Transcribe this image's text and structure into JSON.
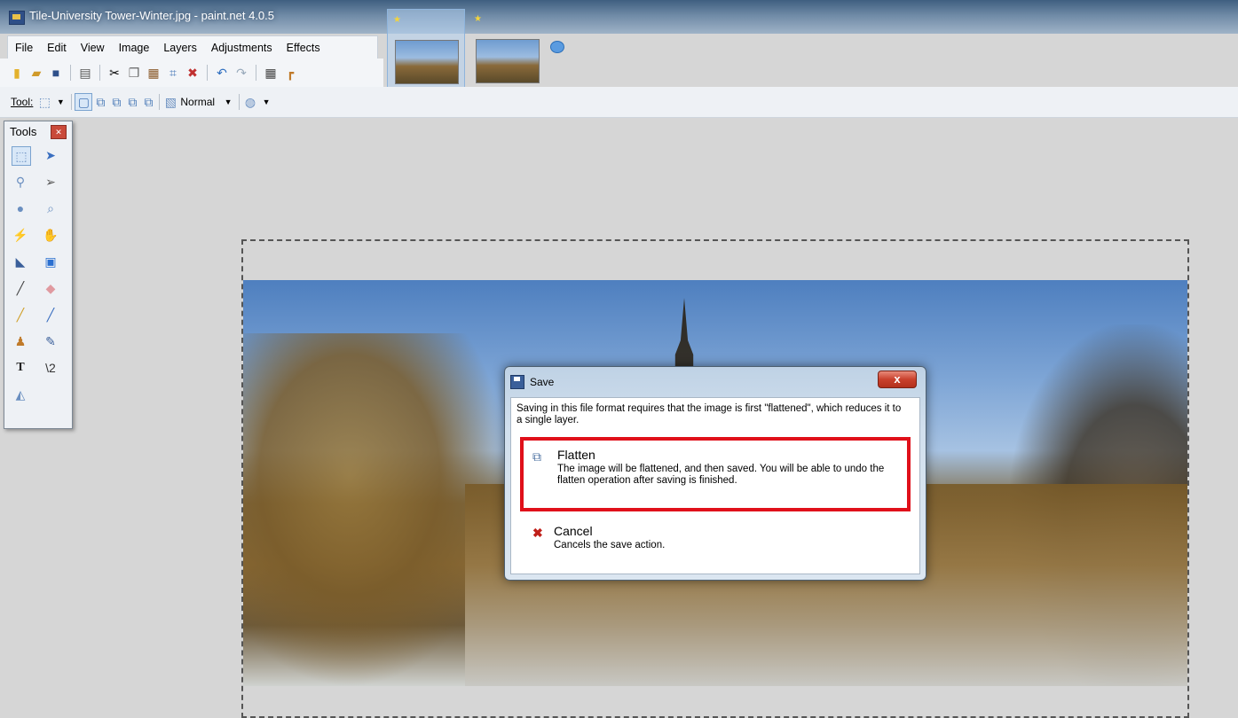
{
  "window": {
    "title": "Tile-University Tower-Winter.jpg - paint.net 4.0.5"
  },
  "menu": {
    "items": [
      {
        "label": "File"
      },
      {
        "label": "Edit"
      },
      {
        "label": "View"
      },
      {
        "label": "Image"
      },
      {
        "label": "Layers"
      },
      {
        "label": "Adjustments"
      },
      {
        "label": "Effects"
      }
    ]
  },
  "toolbar2": {
    "tool_label": "Tool:",
    "blend_mode": "Normal"
  },
  "tools_palette": {
    "title": "Tools"
  },
  "dialog": {
    "title": "Save",
    "close_label": "x",
    "message": "Saving in this file format requires that the image is first \"flattened\", which reduces it to a single layer.",
    "flatten": {
      "title": "Flatten",
      "description": "The image will be flattened, and then saved. You will be able to undo the flatten operation after saving is finished."
    },
    "cancel": {
      "title": "Cancel",
      "description": "Cancels the save action."
    }
  },
  "colors": {
    "highlight_border": "#e0101a"
  }
}
